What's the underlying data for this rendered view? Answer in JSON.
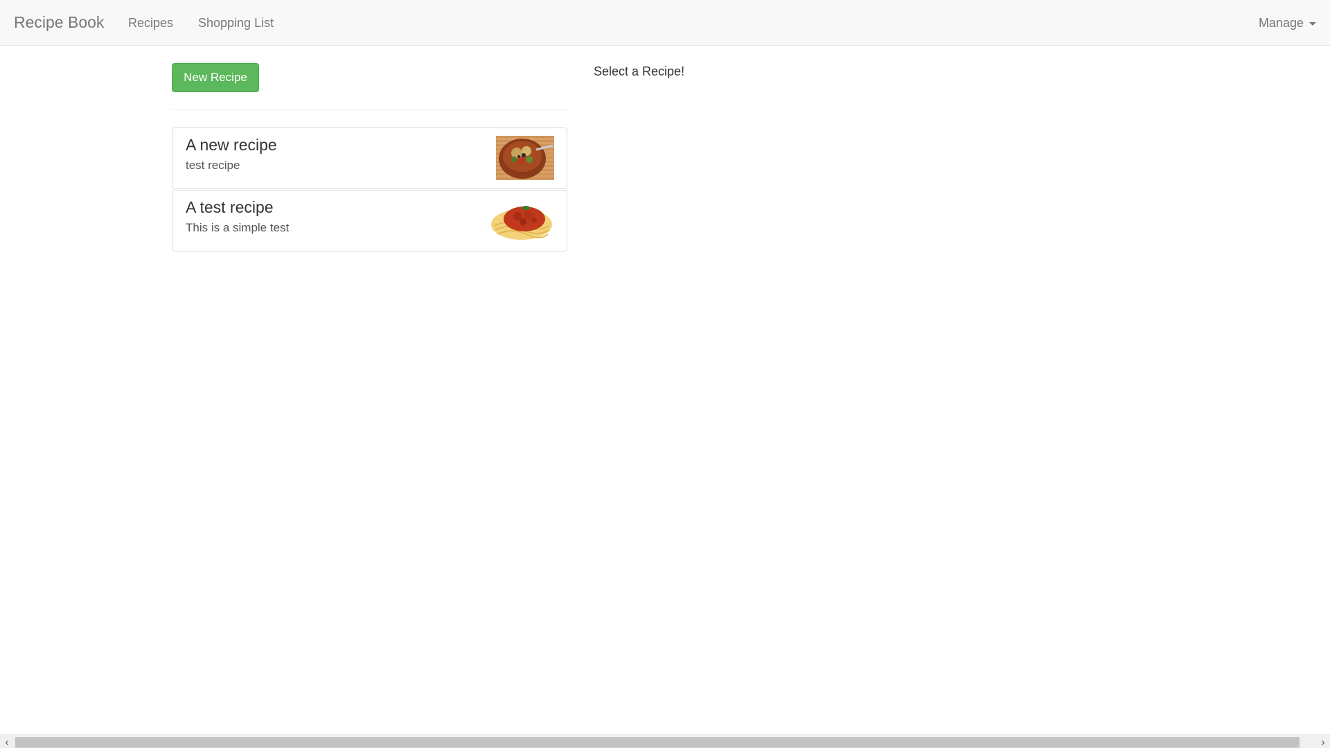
{
  "navbar": {
    "brand": "Recipe Book",
    "links": [
      "Recipes",
      "Shopping List"
    ],
    "manage_label": "Manage"
  },
  "toolbar": {
    "new_recipe_label": "New Recipe"
  },
  "recipes": [
    {
      "name": "A new recipe",
      "description": "test recipe",
      "image": "food-bowl-icon"
    },
    {
      "name": "A test recipe",
      "description": "This is a simple test",
      "image": "spaghetti-icon"
    }
  ],
  "detail": {
    "placeholder": "Select a Recipe!"
  },
  "scrollbar": {
    "left_arrow": "‹",
    "right_arrow": "›"
  },
  "colors": {
    "accent_green": "#5cb85c",
    "navbar_bg": "#f8f8f8"
  }
}
